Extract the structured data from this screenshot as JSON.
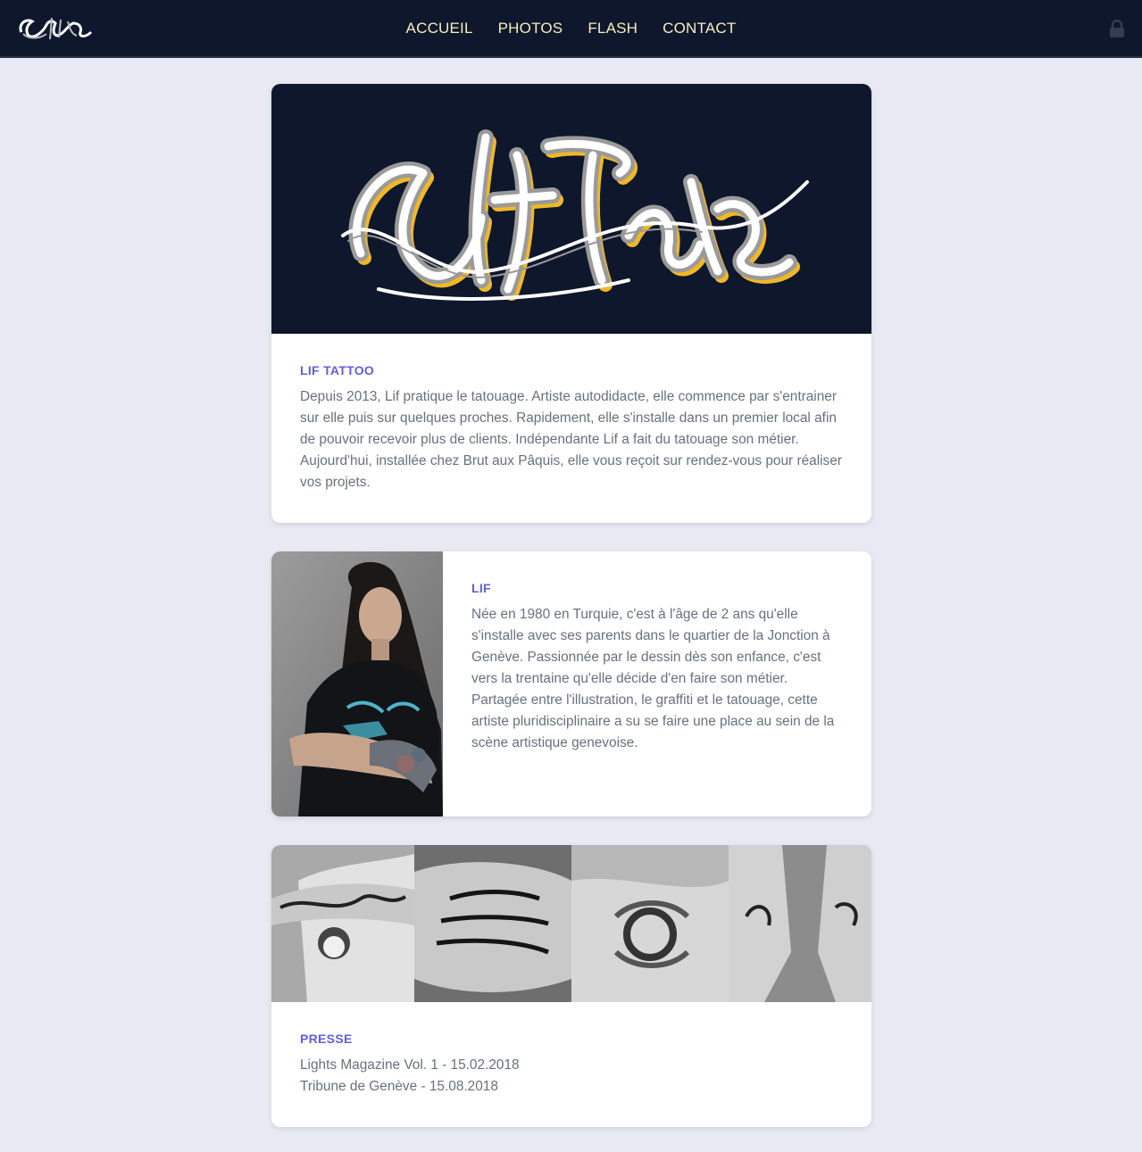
{
  "nav": {
    "logo": "Lif Tattoo",
    "links": [
      "ACCUEIL",
      "PHOTOS",
      "FLASH",
      "CONTACT"
    ],
    "lock_icon": "lock-icon"
  },
  "intro": {
    "hero_logo": "Lif Tattoo",
    "title": "LIF TATTOO",
    "text": "Depuis 2013, Lif pratique le tatouage. Artiste autodidacte, elle commence par s'entrainer sur elle puis sur quelques proches. Rapidement, elle s'installe dans un premier local afin de pouvoir recevoir plus de clients. Indépendante Lif a fait du tatouage son métier. Aujourd'hui, installée chez Brut aux Pâquis, elle vous reçoit sur rendez-vous pour réaliser vos projets."
  },
  "bio": {
    "title": "LIF",
    "text": "Née en 1980 en Turquie, c'est à l'âge de 2 ans qu'elle s'installe avec ses parents dans le quartier de la Jonction à Genève. Passionnée par le dessin dès son enfance, c'est vers la trentaine qu'elle décide d'en faire son métier. Partagée entre l'illustration, le graffiti et le tatouage, cette artiste pluridisciplinaire a su se faire une place au sein de la scène artistique genevoise."
  },
  "press": {
    "title": "PRESSE",
    "items": [
      "Lights Magazine Vol. 1 - 15.02.2018",
      "Tribune de Genève - 15.08.2018"
    ]
  },
  "colors": {
    "navbar": "#0e172b",
    "nav_text": "#f7eec0",
    "accent": "#6060dc",
    "body_text": "#68707e",
    "page_bg": "#e8e9f3",
    "logo_gold": "#f2b824"
  }
}
